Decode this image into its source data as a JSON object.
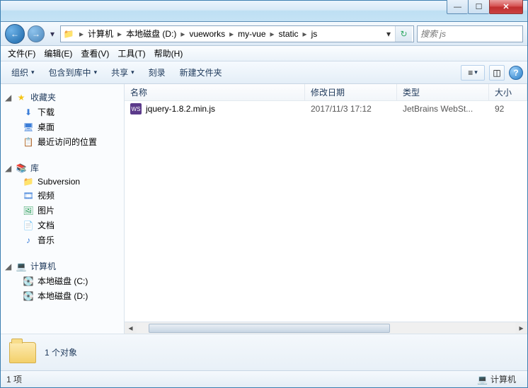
{
  "titlebar": {
    "min": "—",
    "max": "☐",
    "close": "✕"
  },
  "nav": {
    "back": "←",
    "forward": "→",
    "dropdown": "▾"
  },
  "breadcrumb": {
    "root_icon": "💻",
    "items": [
      "计算机",
      "本地磁盘 (D:)",
      "vueworks",
      "my-vue",
      "static",
      "js"
    ],
    "sep": "▸",
    "dropdown": "▾",
    "refresh": "↻"
  },
  "search": {
    "placeholder": "搜索 js",
    "icon": "🔍"
  },
  "menu": {
    "file": "文件(F)",
    "edit": "编辑(E)",
    "view": "查看(V)",
    "tools": "工具(T)",
    "help": "帮助(H)"
  },
  "toolbar": {
    "organize": "组织",
    "include": "包含到库中",
    "share": "共享",
    "burn": "刻录",
    "newfolder": "新建文件夹",
    "dd": "▾",
    "view_icon": "≡",
    "help": "?"
  },
  "sidebar": {
    "favorites": {
      "label": "收藏夹",
      "icon": "★"
    },
    "fav_items": [
      {
        "label": "下载",
        "icon": "⬇"
      },
      {
        "label": "桌面",
        "icon": "🖥"
      },
      {
        "label": "最近访问的位置",
        "icon": "📋"
      }
    ],
    "libraries": {
      "label": "库",
      "icon": "📚"
    },
    "lib_items": [
      {
        "label": "Subversion",
        "icon": "📁"
      },
      {
        "label": "视频",
        "icon": "🎞"
      },
      {
        "label": "图片",
        "icon": "🖼"
      },
      {
        "label": "文档",
        "icon": "📄"
      },
      {
        "label": "音乐",
        "icon": "♪"
      }
    ],
    "computer": {
      "label": "计算机",
      "icon": "💻"
    },
    "comp_items": [
      {
        "label": "本地磁盘 (C:)",
        "icon": "💽"
      },
      {
        "label": "本地磁盘 (D:)",
        "icon": "💽"
      }
    ],
    "exp": "▷",
    "exp_open": "◢"
  },
  "columns": {
    "name": "名称",
    "date": "修改日期",
    "type": "类型",
    "size": "大小"
  },
  "files": [
    {
      "name": "jquery-1.8.2.min.js",
      "date": "2017/11/3 17:12",
      "type": "JetBrains WebSt...",
      "size": "92 "
    }
  ],
  "details": {
    "count_label": "1 个对象"
  },
  "status": {
    "items": "1 项",
    "computer": "计算机",
    "comp_icon": "💻"
  }
}
